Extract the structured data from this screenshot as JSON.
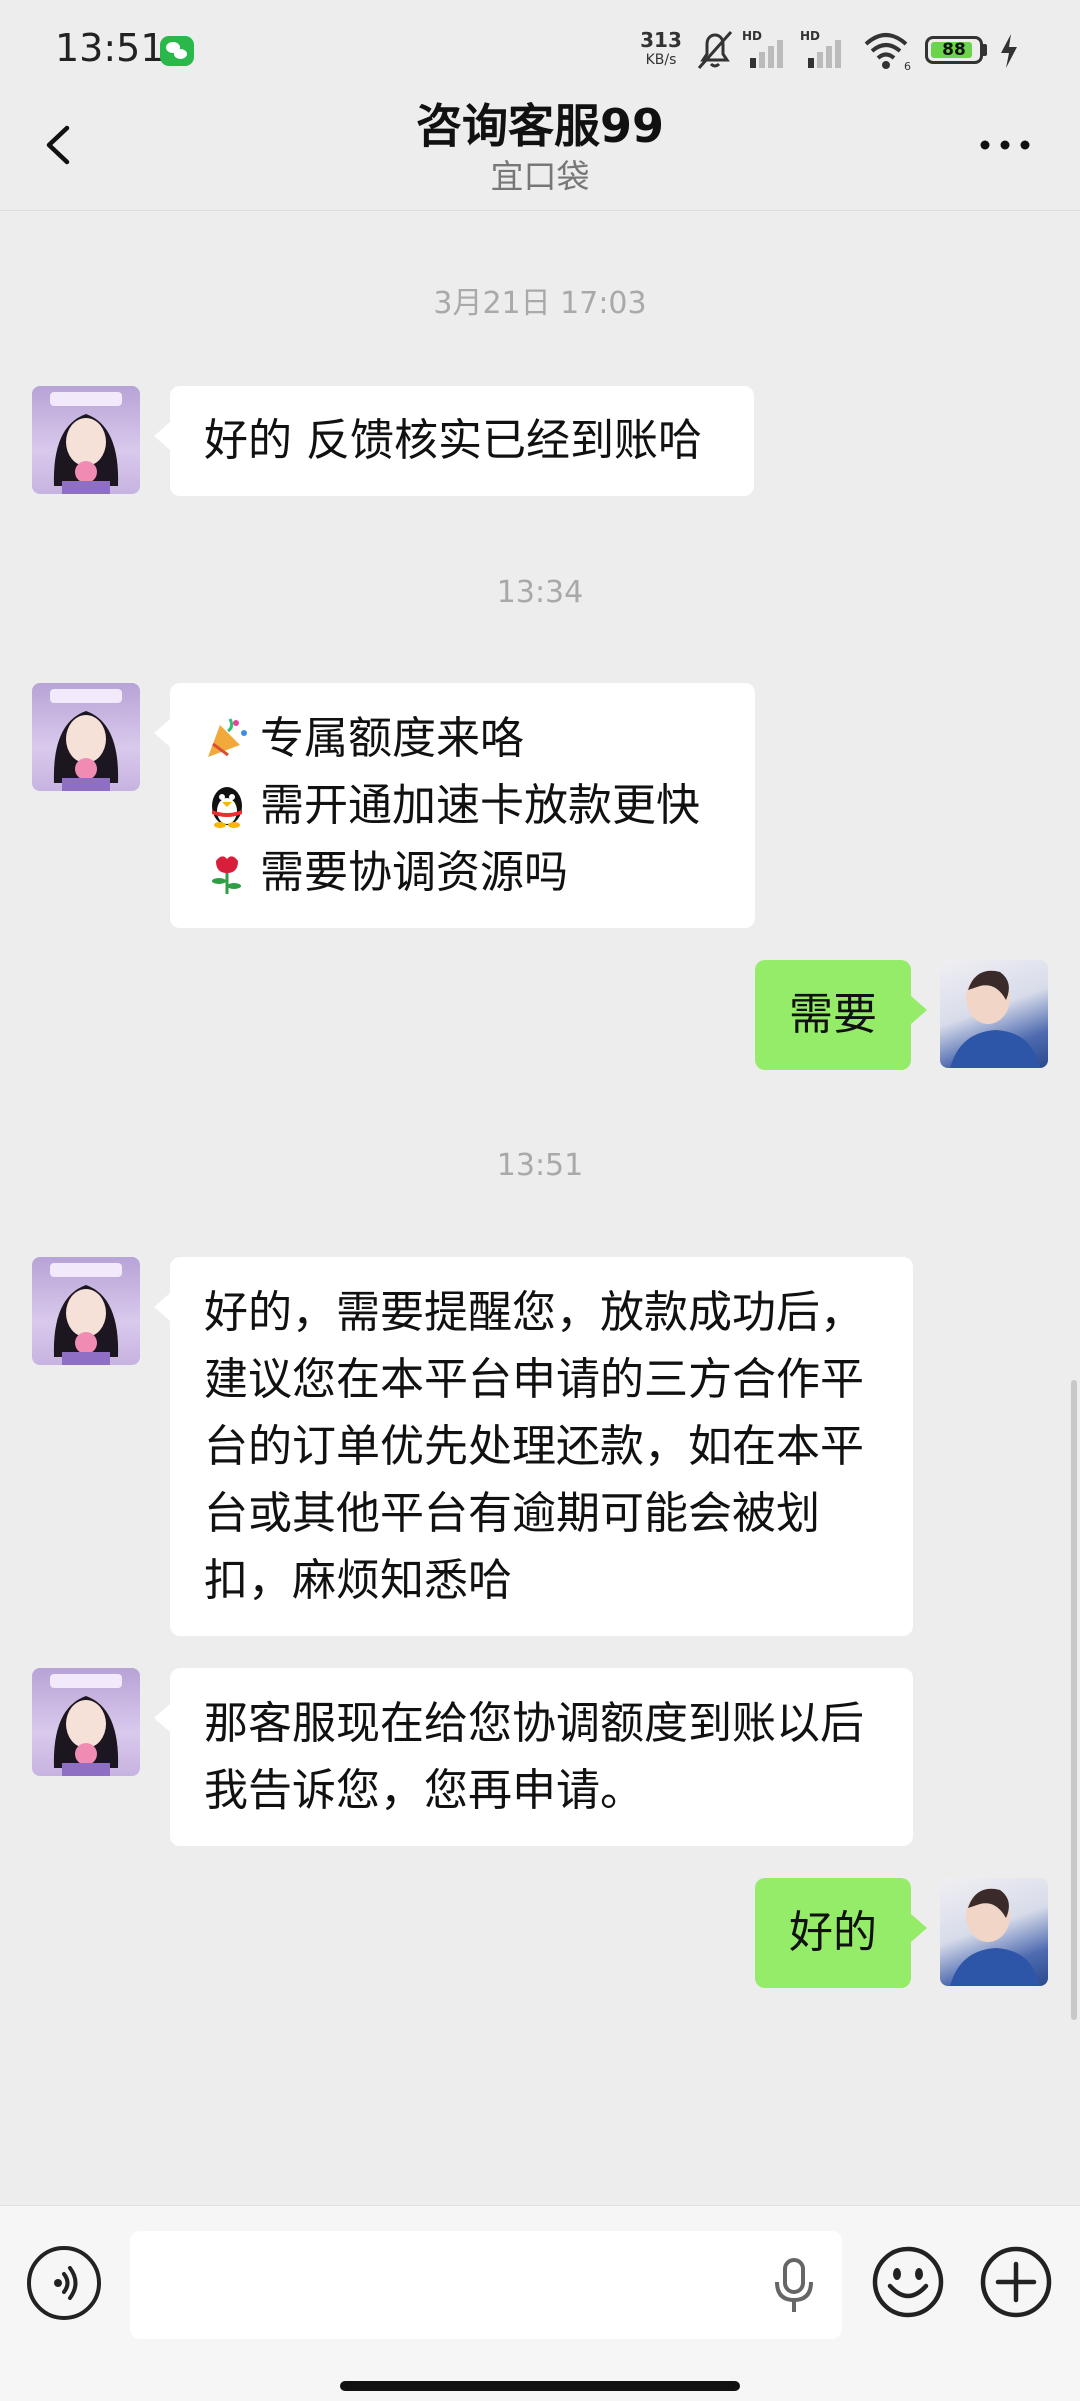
{
  "status_bar": {
    "time": "13:51",
    "net_speed_value": "313",
    "net_speed_unit": "KB/s",
    "battery": "88"
  },
  "header": {
    "title": "咨询客服99",
    "subtitle": "宜口袋"
  },
  "messages": {
    "ts1": "3月21日 17:03",
    "m1": "好的 反馈核实已经到账哈",
    "ts2": "13:34",
    "m2_l1": "专属额度来咯",
    "m2_l2": "需开通加速卡放款更快",
    "m2_l3": "需要协调资源吗",
    "m3": "需要",
    "ts3": "13:51",
    "m4_l1": "好的，需要提醒您，放款成功后，",
    "m4_l2": "建议您在本平台申请的三方合作平",
    "m4_l3": "台的订单优先处理还款，如在本平",
    "m4_l4": "台或其他平台有逾期可能会被划",
    "m4_l5": "扣，麻烦知悉哈",
    "m5_l1": "那客服现在给您协调额度到账以后",
    "m5_l2": "我告诉您，您再申请。",
    "m6": "好的"
  },
  "icons": {
    "m2_l1": "party-popper-emoji",
    "m2_l2": "penguin-emoji",
    "m2_l3": "rose-emoji"
  },
  "colors": {
    "sent_bubble": "#95ec69",
    "received_bubble": "#ffffff",
    "background": "#ededed"
  }
}
